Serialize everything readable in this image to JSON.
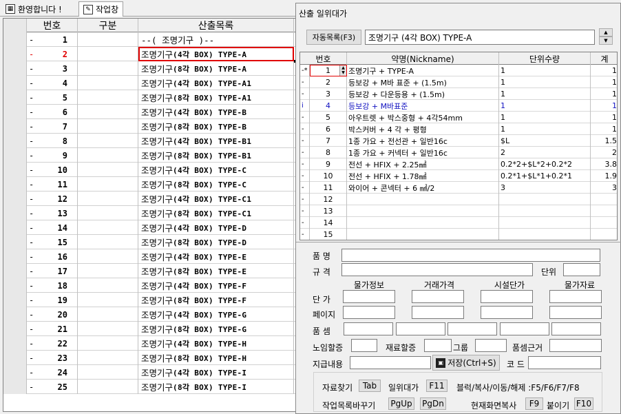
{
  "tabs": [
    {
      "label": "환영합니다 !",
      "icon": "app-icon"
    },
    {
      "label": "작업창",
      "icon": "edit-icon"
    }
  ],
  "grid": {
    "headers": {
      "no": "번호",
      "gubun": "구분",
      "item": "산출목록"
    },
    "rows": [
      {
        "mark": "-",
        "no": "1",
        "item": "--( 조명기구 )--",
        "style": "header"
      },
      {
        "mark": "-",
        "no": "2",
        "item_ko": "조명기구",
        "item_rest": " (4각 BOX) TYPE-A",
        "selected": true
      },
      {
        "mark": "-",
        "no": "3",
        "item_ko": "조명기구",
        "item_rest": " (8각 BOX) TYPE-A"
      },
      {
        "mark": "-",
        "no": "4",
        "item_ko": "조명기구",
        "item_rest": " (4각 BOX) TYPE-A1"
      },
      {
        "mark": "-",
        "no": "5",
        "item_ko": "조명기구",
        "item_rest": " (8각 BOX) TYPE-A1"
      },
      {
        "mark": "-",
        "no": "6",
        "item_ko": "조명기구",
        "item_rest": " (4각 BOX) TYPE-B"
      },
      {
        "mark": "-",
        "no": "7",
        "item_ko": "조명기구",
        "item_rest": " (8각 BOX) TYPE-B"
      },
      {
        "mark": "-",
        "no": "8",
        "item_ko": "조명기구",
        "item_rest": " (4각 BOX) TYPE-B1"
      },
      {
        "mark": "-",
        "no": "9",
        "item_ko": "조명기구",
        "item_rest": " (8각 BOX) TYPE-B1"
      },
      {
        "mark": "-",
        "no": "10",
        "item_ko": "조명기구",
        "item_rest": " (4각 BOX) TYPE-C"
      },
      {
        "mark": "-",
        "no": "11",
        "item_ko": "조명기구",
        "item_rest": " (8각 BOX) TYPE-C"
      },
      {
        "mark": "-",
        "no": "12",
        "item_ko": "조명기구",
        "item_rest": " (4각 BOX) TYPE-C1"
      },
      {
        "mark": "-",
        "no": "13",
        "item_ko": "조명기구",
        "item_rest": " (8각 BOX) TYPE-C1"
      },
      {
        "mark": "-",
        "no": "14",
        "item_ko": "조명기구",
        "item_rest": " (4각 BOX) TYPE-D"
      },
      {
        "mark": "-",
        "no": "15",
        "item_ko": "조명기구",
        "item_rest": " (8각 BOX) TYPE-D"
      },
      {
        "mark": "-",
        "no": "16",
        "item_ko": "조명기구",
        "item_rest": " (4각 BOX) TYPE-E"
      },
      {
        "mark": "-",
        "no": "17",
        "item_ko": "조명기구",
        "item_rest": " (8각 BOX) TYPE-E"
      },
      {
        "mark": "-",
        "no": "18",
        "item_ko": "조명기구",
        "item_rest": " (4각 BOX) TYPE-F"
      },
      {
        "mark": "-",
        "no": "19",
        "item_ko": "조명기구",
        "item_rest": " (8각 BOX) TYPE-F"
      },
      {
        "mark": "-",
        "no": "20",
        "item_ko": "조명기구",
        "item_rest": " (4각 BOX) TYPE-G"
      },
      {
        "mark": "-",
        "no": "21",
        "item_ko": "조명기구",
        "item_rest": " (8각 BOX) TYPE-G"
      },
      {
        "mark": "-",
        "no": "22",
        "item_ko": "조명기구",
        "item_rest": " (4각 BOX) TYPE-H"
      },
      {
        "mark": "-",
        "no": "23",
        "item_ko": "조명기구",
        "item_rest": " (8각 BOX) TYPE-H"
      },
      {
        "mark": "-",
        "no": "24",
        "item_ko": "조명기구",
        "item_rest": " (4각 BOX) TYPE-I"
      },
      {
        "mark": "-",
        "no": "25",
        "item_ko": "조명기구",
        "item_rest": " (8각 BOX) TYPE-I"
      }
    ]
  },
  "dialog": {
    "title": "산출 일위대가",
    "auto_list_button": "자동목록(F3)",
    "current_item": "조명기구 (4각 BOX) TYPE-A",
    "headers": {
      "no": "번호",
      "nick": "약명(Nickname)",
      "qty": "단위수량",
      "total": "계"
    },
    "rows": [
      {
        "mark": "-*",
        "no": "1",
        "nick": "조명기구 + TYPE-A",
        "qty": "1",
        "val": "1",
        "editing": true
      },
      {
        "mark": "-",
        "no": "2",
        "nick": "등보강 + M바 표준 + (1.5m)",
        "qty": "1",
        "val": "1"
      },
      {
        "mark": "-",
        "no": "3",
        "nick": "등보강 + 다운등용 + (1.5m)",
        "qty": "1",
        "val": "1"
      },
      {
        "mark": "i",
        "no": "4",
        "nick": "등보강 + M바표준",
        "qty": "1",
        "val": "1",
        "blue": true
      },
      {
        "mark": "-",
        "no": "5",
        "nick": "아우트렛 + 박스중형 + 4각54mm",
        "qty": "1",
        "val": "1"
      },
      {
        "mark": "-",
        "no": "6",
        "nick": "박스커버 + 4 각 + 평형",
        "qty": "1",
        "val": "1"
      },
      {
        "mark": "-",
        "no": "7",
        "nick": "1종 가요 + 전선관 + 일반16c",
        "qty": "$L",
        "val": "1.5"
      },
      {
        "mark": "-",
        "no": "8",
        "nick": "1종 가요 + 커넥터 + 일반16c",
        "qty": "2",
        "val": "2"
      },
      {
        "mark": "-",
        "no": "9",
        "nick": "전선 + HFIX + 2.25㎟",
        "qty": "0.2*2+$L*2+0.2*2",
        "val": "3.8"
      },
      {
        "mark": "-",
        "no": "10",
        "nick": "전선 + HFIX + 1.78㎟",
        "qty": "0.2*1+$L*1+0.2*1",
        "val": "1.9"
      },
      {
        "mark": "-",
        "no": "11",
        "nick": "와이어 + 콘넥터 + 6 ㎟/2",
        "qty": "3",
        "val": "3"
      },
      {
        "mark": "-",
        "no": "12",
        "nick": "",
        "qty": "",
        "val": ""
      },
      {
        "mark": "-",
        "no": "13",
        "nick": "",
        "qty": "",
        "val": ""
      },
      {
        "mark": "-",
        "no": "14",
        "nick": "",
        "qty": "",
        "val": ""
      },
      {
        "mark": "-",
        "no": "15",
        "nick": "",
        "qty": "",
        "val": ""
      }
    ],
    "form": {
      "pummyeong": "품 명",
      "gyugyeok": "규 격",
      "danwi": "단위",
      "col_headers": [
        "물가정보",
        "거래가격",
        "시설단가",
        "물가자료"
      ],
      "danga": "단 가",
      "page": "페이지",
      "pumsem": "품 셈",
      "noim": "노임할증",
      "jaeryo": "재료할증",
      "group": "그룹",
      "pumsem_basis": "품셈근거",
      "jigeup": "지급내용",
      "save_button": "저장(Ctrl+S)",
      "code": "코 드"
    },
    "shortcuts": {
      "row1": [
        {
          "label": "자료찾기",
          "key": "Tab"
        },
        {
          "label": "일위대가",
          "key": "F11"
        },
        {
          "label": "블럭/복사/이동/해제 :F5/F6/F7/F8",
          "key": ""
        }
      ],
      "row2": [
        {
          "label": "작업목록바꾸기",
          "key": "PgUp"
        },
        {
          "label": "",
          "key": "PgDn"
        },
        {
          "label": "현재화면복사",
          "key": "F9"
        },
        {
          "label": "붙이기",
          "key": "F10"
        }
      ]
    }
  }
}
